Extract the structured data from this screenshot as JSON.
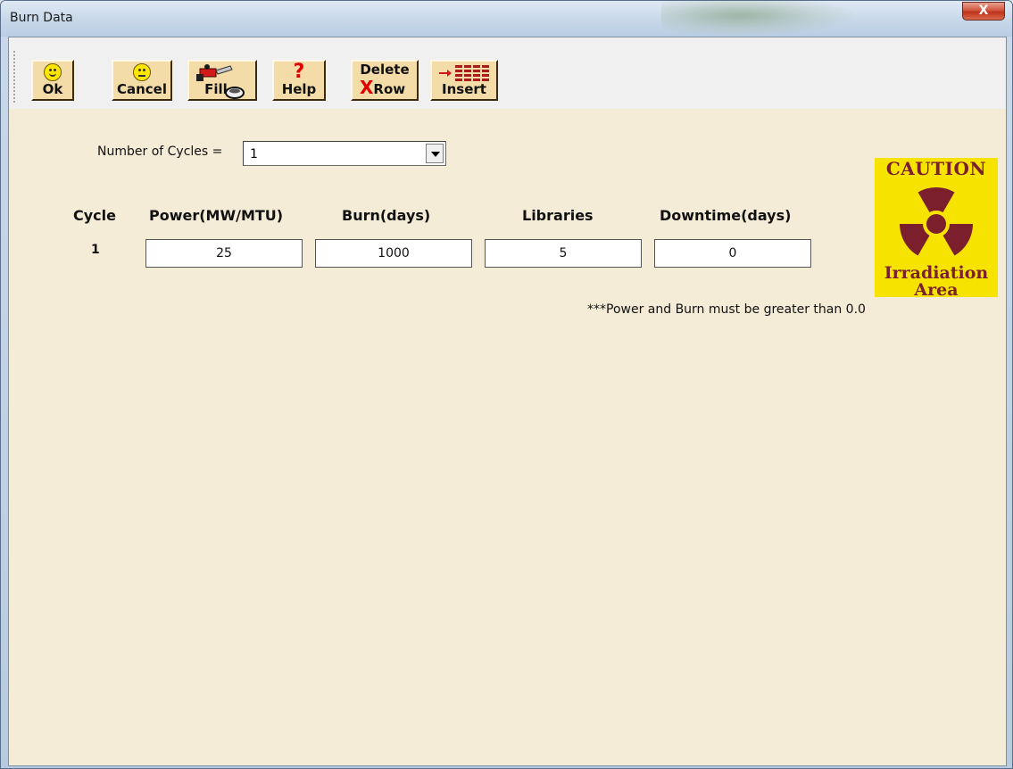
{
  "window": {
    "title": "Burn Data",
    "close_glyph": "X"
  },
  "toolbar": {
    "buttons": [
      {
        "label": "Ok",
        "icon": "smiley-happy-icon"
      },
      {
        "label": "Cancel",
        "icon": "smiley-neutral-icon"
      },
      {
        "label": "Fill",
        "icon": "fuel-pump-icon"
      },
      {
        "label": "Help",
        "icon": "question-mark-icon",
        "glyph": "?"
      },
      {
        "label_top": "Delete",
        "label": "Row",
        "icon": "red-x-icon",
        "glyph": "X"
      },
      {
        "label": "Insert",
        "icon": "insert-row-icon"
      }
    ]
  },
  "form": {
    "cycles_label": "Number of Cycles =",
    "cycles_value": "1",
    "columns": [
      "Cycle",
      "Power(MW/MTU)",
      "Burn(days)",
      "Libraries",
      "Downtime(days)"
    ],
    "rows": [
      {
        "cycle": "1",
        "power": "25",
        "burn": "1000",
        "libraries": "5",
        "downtime": "0"
      }
    ],
    "note": "***Power and Burn must be greater than 0.0"
  },
  "caution_sign": {
    "top_text": "CAUTION",
    "bottom_text": "Irradiation Area"
  },
  "colors": {
    "accent_red": "#e00000",
    "sign_yellow": "#f6e400",
    "sign_maroon": "#7a1f2b",
    "panel_bg": "#f5ecd7",
    "button_bg": "#f3dca8"
  }
}
